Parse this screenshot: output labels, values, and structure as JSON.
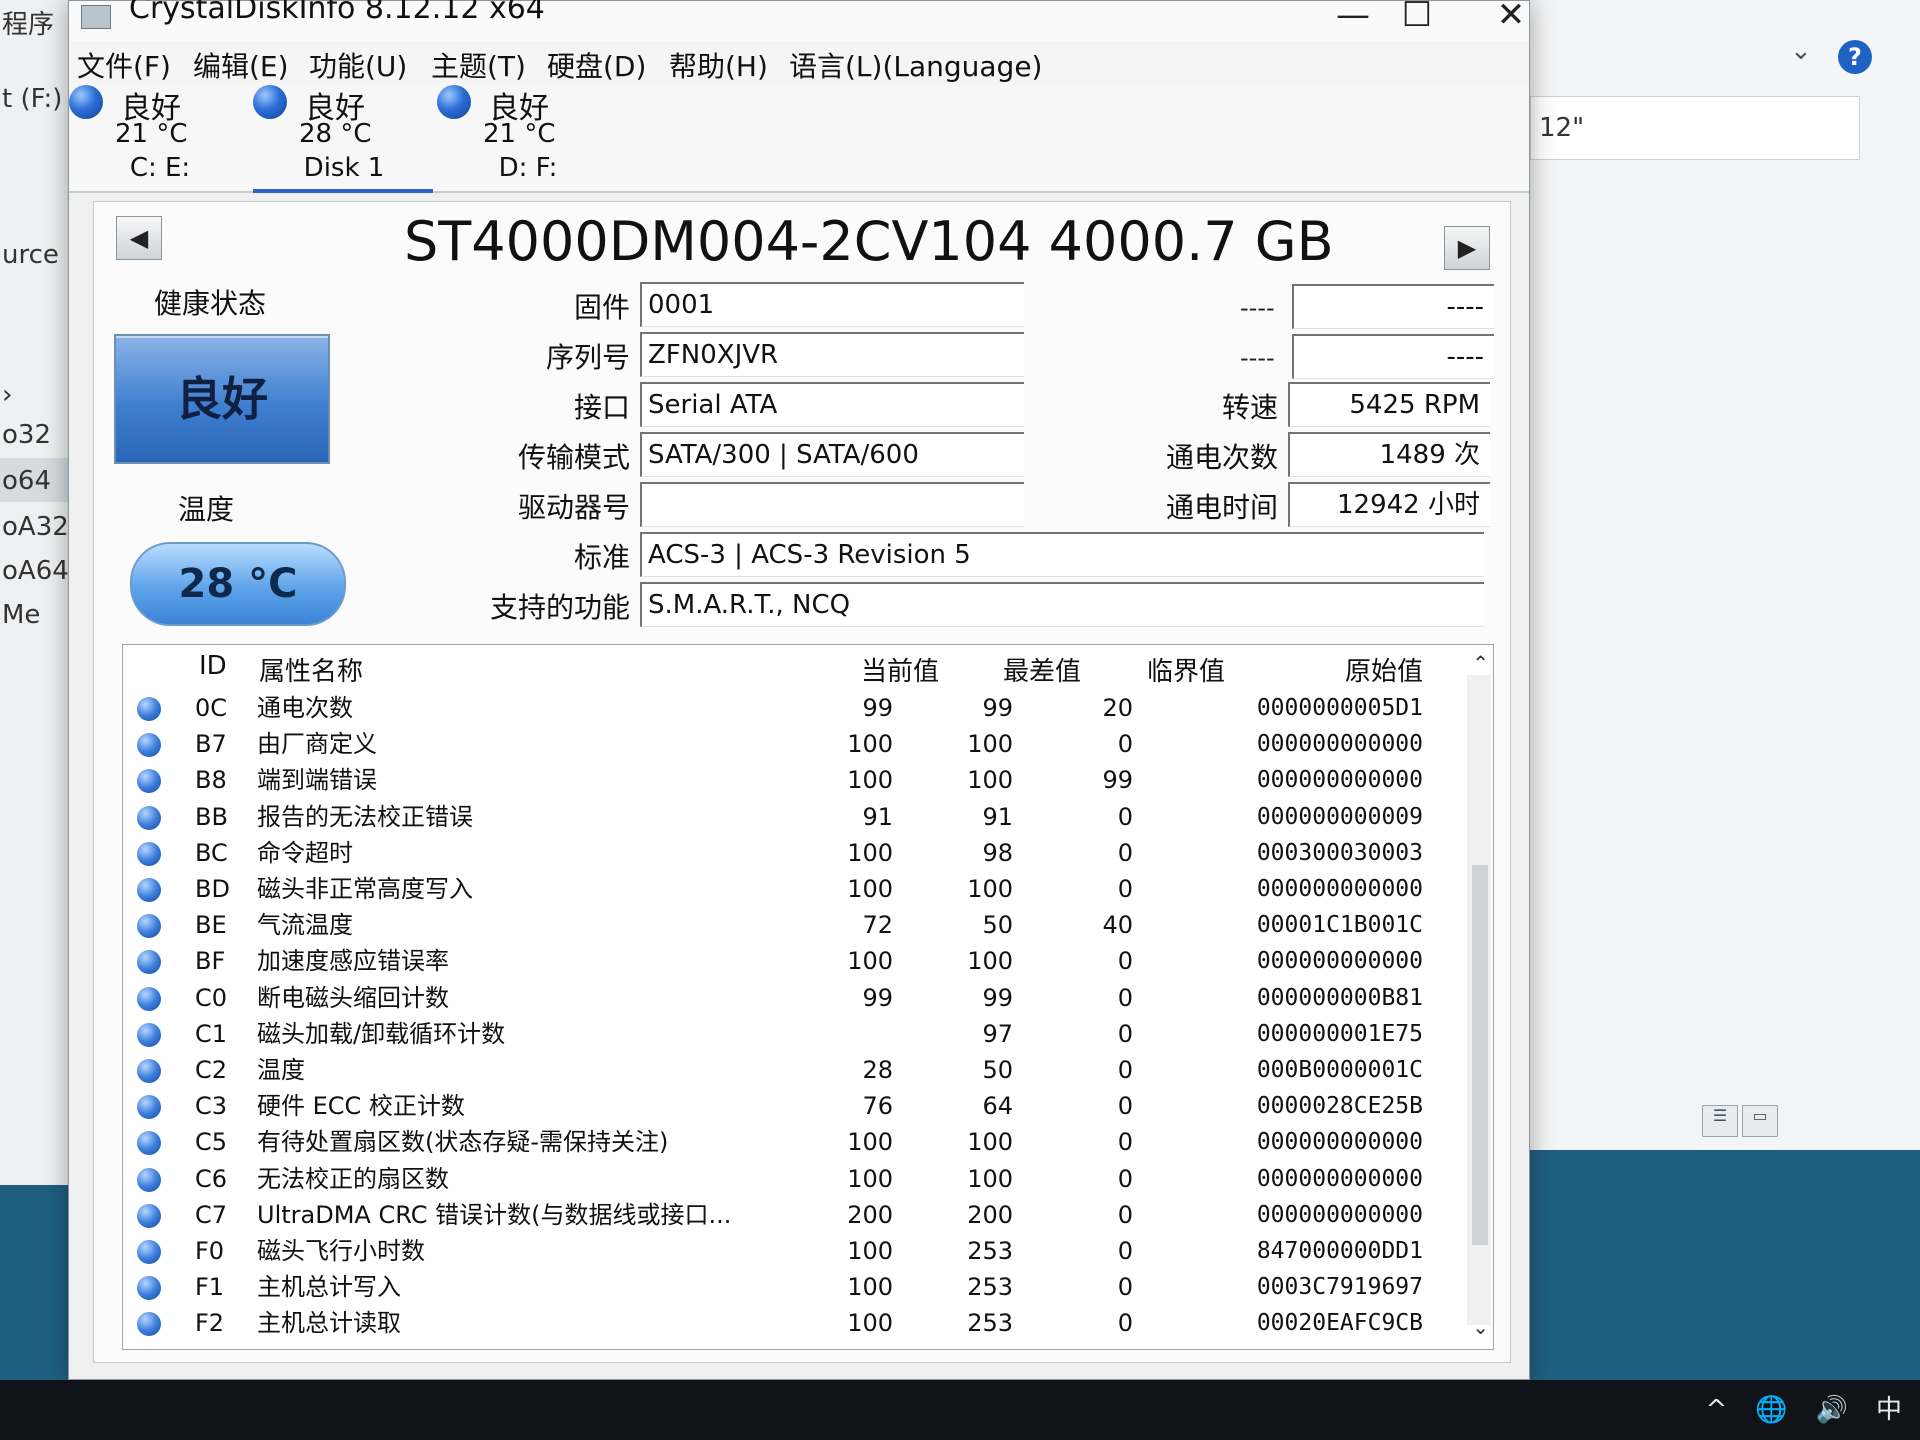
{
  "bg_left": {
    "items": [
      "程序",
      "t (F:)",
      "urce",
      "›",
      "o32",
      "o64",
      "oA32",
      "oA64",
      "Me"
    ]
  },
  "bg_right": {
    "address_text": "12\"",
    "chevron": "chevron-down-icon",
    "help_label": "?"
  },
  "window": {
    "title": "CrystalDiskInfo 8.12.12 x64",
    "menu": [
      "文件(F)",
      "编辑(E)",
      "功能(U)",
      "主题(T)",
      "硬盘(D)",
      "帮助(H)",
      "语言(L)(Language)"
    ],
    "drives": [
      {
        "status": "良好",
        "temp": "21 °C",
        "label": "C: E:"
      },
      {
        "status": "良好",
        "temp": "28 °C",
        "label": "Disk 1"
      },
      {
        "status": "良好",
        "temp": "21 °C",
        "label": "D: F:"
      }
    ]
  },
  "disk": {
    "title": "ST4000DM004-2CV104 4000.7 GB",
    "health_label": "健康状态",
    "health_value": "良好",
    "temp_label": "温度",
    "temp_value": "28 °C",
    "fields": {
      "firmware": {
        "label": "固件",
        "value": "0001"
      },
      "serial": {
        "label": "序列号",
        "value": "ZFN0XJVR"
      },
      "interface": {
        "label": "接口",
        "value": "Serial ATA"
      },
      "transfer": {
        "label": "传输模式",
        "value": "SATA/300 | SATA/600"
      },
      "drive_letter": {
        "label": "驱动器号",
        "value": ""
      },
      "standard": {
        "label": "标准",
        "value": "ACS-3 | ACS-3 Revision 5"
      },
      "features": {
        "label": "支持的功能",
        "value": "S.M.A.R.T., NCQ"
      },
      "rpm": {
        "label": "转速",
        "value": "5425 RPM"
      },
      "power_count": {
        "label": "通电次数",
        "value": "1489 次"
      },
      "power_hours": {
        "label": "通电时间",
        "value": "12942 小时"
      },
      "dash": "----"
    }
  },
  "smart": {
    "headers": {
      "id": "ID",
      "name": "属性名称",
      "current": "当前值",
      "worst": "最差值",
      "threshold": "临界值",
      "raw": "原始值"
    },
    "rows": [
      {
        "id": "0C",
        "name": "通电次数",
        "current": "99",
        "worst": "99",
        "threshold": "20",
        "raw": "0000000005D1"
      },
      {
        "id": "B7",
        "name": "由厂商定义",
        "current": "100",
        "worst": "100",
        "threshold": "0",
        "raw": "000000000000"
      },
      {
        "id": "B8",
        "name": "端到端错误",
        "current": "100",
        "worst": "100",
        "threshold": "99",
        "raw": "000000000000"
      },
      {
        "id": "BB",
        "name": "报告的无法校正错误",
        "current": "91",
        "worst": "91",
        "threshold": "0",
        "raw": "000000000009"
      },
      {
        "id": "BC",
        "name": "命令超时",
        "current": "100",
        "worst": "98",
        "threshold": "0",
        "raw": "000300030003"
      },
      {
        "id": "BD",
        "name": "磁头非正常高度写入",
        "current": "100",
        "worst": "100",
        "threshold": "0",
        "raw": "000000000000"
      },
      {
        "id": "BE",
        "name": "气流温度",
        "current": "72",
        "worst": "50",
        "threshold": "40",
        "raw": "00001C1B001C"
      },
      {
        "id": "BF",
        "name": "加速度感应错误率",
        "current": "100",
        "worst": "100",
        "threshold": "0",
        "raw": "000000000000"
      },
      {
        "id": "C0",
        "name": "断电磁头缩回计数",
        "current": "99",
        "worst": "99",
        "threshold": "0",
        "raw": "000000000B81"
      },
      {
        "id": "C1",
        "name": "磁头加载/卸载循环计数",
        "current": "",
        "worst": "97",
        "threshold": "0",
        "raw": "000000001E75"
      },
      {
        "id": "C2",
        "name": "温度",
        "current": "28",
        "worst": "50",
        "threshold": "0",
        "raw": "000B0000001C"
      },
      {
        "id": "C3",
        "name": "硬件 ECC 校正计数",
        "current": "76",
        "worst": "64",
        "threshold": "0",
        "raw": "0000028CE25B"
      },
      {
        "id": "C5",
        "name": "有待处置扇区数(状态存疑-需保持关注)",
        "current": "100",
        "worst": "100",
        "threshold": "0",
        "raw": "000000000000"
      },
      {
        "id": "C6",
        "name": "无法校正的扇区数",
        "current": "100",
        "worst": "100",
        "threshold": "0",
        "raw": "000000000000"
      },
      {
        "id": "C7",
        "name": "UltraDMA CRC 错误计数(与数据线或接口...",
        "current": "200",
        "worst": "200",
        "threshold": "0",
        "raw": "000000000000"
      },
      {
        "id": "F0",
        "name": "磁头飞行小时数",
        "current": "100",
        "worst": "253",
        "threshold": "0",
        "raw": "847000000DD1"
      },
      {
        "id": "F1",
        "name": "主机总计写入",
        "current": "100",
        "worst": "253",
        "threshold": "0",
        "raw": "0003C7919697"
      },
      {
        "id": "F2",
        "name": "主机总计读取",
        "current": "100",
        "worst": "253",
        "threshold": "0",
        "raw": "00020EAFC9CB"
      }
    ]
  },
  "taskbar": {
    "tray": [
      "^",
      "🌐",
      "🔊",
      "中"
    ]
  }
}
